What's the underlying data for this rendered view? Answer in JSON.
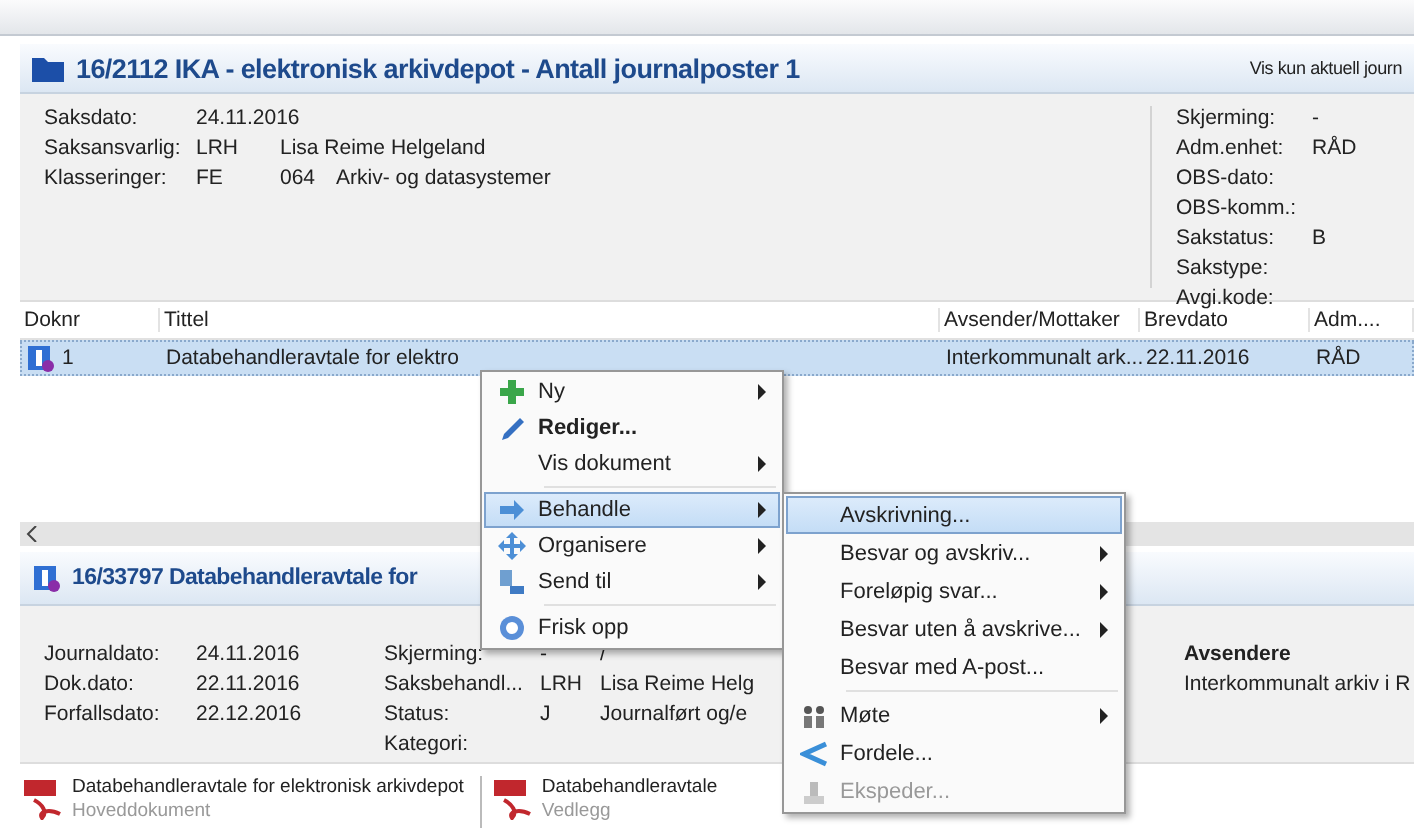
{
  "case": {
    "title": "16/2112 IKA  - elektronisk arkivdepot - Antall journalposter 1",
    "filter_link": "Vis kun aktuell journ",
    "fields_left": [
      {
        "label": "Saksdato:",
        "values": [
          "24.11.2016"
        ]
      },
      {
        "label": "Saksansvarlig:",
        "values": [
          "LRH",
          "Lisa Reime Helgeland"
        ]
      },
      {
        "label": "Klasseringer:",
        "values": [
          "FE",
          "064",
          "Arkiv- og datasystemer"
        ]
      }
    ],
    "fields_right": [
      {
        "label": "Skjerming:",
        "value": "-"
      },
      {
        "label": "Adm.enhet:",
        "value": "RÅD"
      },
      {
        "label": "OBS-dato:"
      },
      {
        "label": "OBS-komm.:"
      },
      {
        "label": "Sakstatus:",
        "value": "B"
      },
      {
        "label": "Sakstype:"
      },
      {
        "label": "Avgi.kode:"
      }
    ]
  },
  "table": {
    "columns": [
      "Doknr",
      "Tittel",
      "Avsender/Mottaker",
      "Brevdato",
      "Adm...."
    ],
    "rows": [
      {
        "cells": [
          "1",
          "Databehandleravtale for elektro",
          "Interkommunalt ark...",
          "22.11.2016",
          "RÅD"
        ],
        "selected": true
      }
    ]
  },
  "journal": {
    "title": "16/33797  Databehandleravtale for",
    "fields_left": [
      {
        "label": "Journaldato:",
        "values": [
          "24.11.2016"
        ]
      },
      {
        "label": "Dok.dato:",
        "values": [
          "22.11.2016"
        ]
      },
      {
        "label": "Forfallsdato:",
        "values": [
          "22.12.2016"
        ]
      }
    ],
    "fields_mid": [
      {
        "label": "Skjerming:",
        "values": [
          "-",
          "/"
        ]
      },
      {
        "label": "Saksbehandl...",
        "values": [
          "LRH",
          "Lisa Reime Helg"
        ]
      },
      {
        "label": "Status:",
        "values": [
          "J",
          "Journalført og/e"
        ]
      },
      {
        "label": "Kategori:"
      }
    ],
    "senders": {
      "heading": "Avsendere",
      "items": [
        "Interkommunalt arkiv i R"
      ]
    }
  },
  "attachments": [
    {
      "title": "Databehandleravtale for elektronisk arkivdepot",
      "subtitle": "Hoveddokument"
    },
    {
      "title": "Databehandleravtale",
      "subtitle": "Vedlegg"
    }
  ],
  "context_menu": {
    "items": [
      {
        "label": "Ny",
        "submenu": true,
        "bold": false,
        "selected": false,
        "separator_before": false
      },
      {
        "label": "Rediger...",
        "submenu": false,
        "bold": true,
        "selected": false,
        "separator_before": false
      },
      {
        "label": "Vis dokument",
        "submenu": true,
        "bold": false,
        "selected": false,
        "separator_before": false
      },
      {
        "label": "Behandle",
        "submenu": true,
        "bold": false,
        "selected": true,
        "separator_before": true
      },
      {
        "label": "Organisere",
        "submenu": true,
        "bold": false,
        "selected": false,
        "separator_before": false
      },
      {
        "label": "Send til",
        "submenu": true,
        "bold": false,
        "selected": false,
        "separator_before": false
      },
      {
        "label": "Frisk opp",
        "submenu": false,
        "bold": false,
        "selected": false,
        "separator_before": true
      }
    ]
  },
  "submenu": {
    "items": [
      {
        "label": "Avskrivning...",
        "submenu": false,
        "selected": true,
        "disabled": false,
        "separator_before": false
      },
      {
        "label": "Besvar og avskriv...",
        "submenu": true,
        "selected": false,
        "disabled": false,
        "separator_before": false
      },
      {
        "label": "Foreløpig svar...",
        "submenu": true,
        "selected": false,
        "disabled": false,
        "separator_before": false
      },
      {
        "label": "Besvar uten å avskrive...",
        "submenu": true,
        "selected": false,
        "disabled": false,
        "separator_before": false
      },
      {
        "label": "Besvar med A-post...",
        "submenu": false,
        "selected": false,
        "disabled": false,
        "separator_before": false
      },
      {
        "label": "Møte",
        "submenu": true,
        "selected": false,
        "disabled": false,
        "separator_before": true
      },
      {
        "label": "Fordele...",
        "submenu": false,
        "selected": false,
        "disabled": false,
        "separator_before": false
      },
      {
        "label": "Ekspeder...",
        "submenu": false,
        "selected": false,
        "disabled": true,
        "separator_before": false
      }
    ]
  }
}
